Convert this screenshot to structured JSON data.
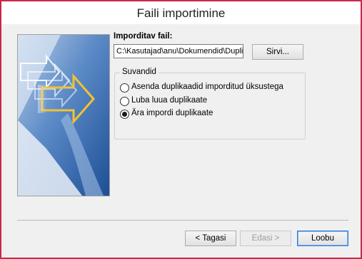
{
  "window": {
    "title": "Faili importimine"
  },
  "file": {
    "label": "Imporditav fail:",
    "path": "C:\\Kasutajad\\anu\\Dokumendid\\Duplikaadid.pst",
    "browse_label": "Sirvi..."
  },
  "options": {
    "title": "Suvandid",
    "items": [
      {
        "label": "Asenda duplikaadid imporditud üksustega",
        "checked": false
      },
      {
        "label": "Luba luua duplikaate",
        "checked": false
      },
      {
        "label": "Ära impordi duplikaate",
        "checked": true
      }
    ]
  },
  "footer": {
    "back_label": "< Tagasi",
    "next_label": "Edasi >",
    "finish_label": "Loobu"
  },
  "colors": {
    "accent": "#c8284a",
    "panel_blue": "#3d6fb3",
    "arrow_yellow": "#f2c230"
  }
}
